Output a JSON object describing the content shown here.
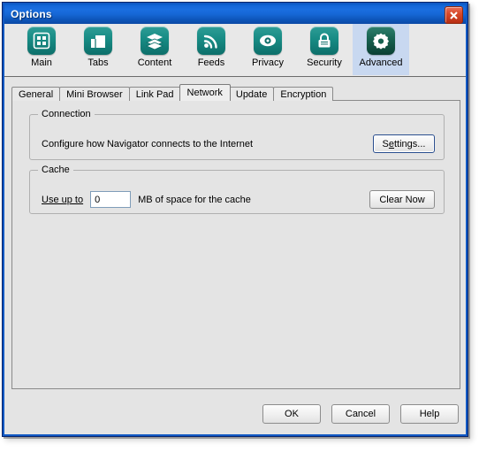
{
  "window": {
    "title": "Options",
    "close_label": "Close",
    "close_icon": "close-x-icon"
  },
  "toolbar": {
    "items": [
      {
        "label": "Main",
        "icon": "grid-squares-icon",
        "selected": false
      },
      {
        "label": "Tabs",
        "icon": "tab-page-icon",
        "selected": false
      },
      {
        "label": "Content",
        "icon": "stacked-layers-icon",
        "selected": false
      },
      {
        "label": "Feeds",
        "icon": "rss-feed-icon",
        "selected": false
      },
      {
        "label": "Privacy",
        "icon": "eye-icon",
        "selected": false
      },
      {
        "label": "Security",
        "icon": "padlock-icon",
        "selected": false
      },
      {
        "label": "Advanced",
        "icon": "gear-icon",
        "selected": true
      }
    ]
  },
  "tabs": [
    {
      "label": "General",
      "active": false
    },
    {
      "label": "Mini Browser",
      "active": false
    },
    {
      "label": "Link Pad",
      "active": false
    },
    {
      "label": "Network",
      "active": true
    },
    {
      "label": "Update",
      "active": false
    },
    {
      "label": "Encryption",
      "active": false
    }
  ],
  "connection": {
    "group_title": "Connection",
    "description": "Configure how Navigator connects to the Internet",
    "settings_button": "Settings..."
  },
  "cache": {
    "group_title": "Cache",
    "prefix_label": "Use up to",
    "size_value": "0",
    "size_placeholder": "0",
    "suffix_label": "MB of space for the cache",
    "clear_button": "Clear Now"
  },
  "footer": {
    "ok": "OK",
    "cancel": "Cancel",
    "help": "Help"
  },
  "colors": {
    "titlebar_blue": "#1566d8",
    "window_border": "#1159c4",
    "icon_teal": "#178b84",
    "icon_teal_selected": "#17614f",
    "selection_blue": "#c8d8f0",
    "dialog_face": "#e4e4e4",
    "close_red": "#d94a2a",
    "input_border": "#7f9db9",
    "default_button_border": "#2a4e8e"
  }
}
